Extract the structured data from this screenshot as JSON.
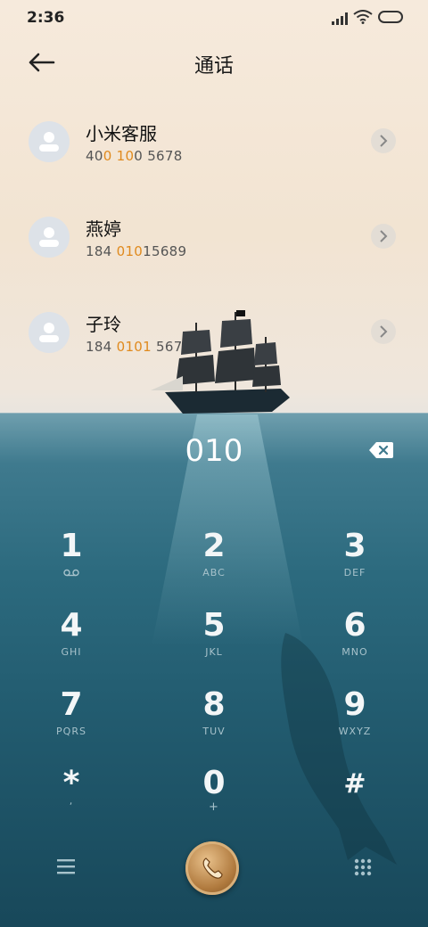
{
  "status_bar": {
    "time": "2:36"
  },
  "header": {
    "title": "通话"
  },
  "contacts": [
    {
      "name": "小米客服",
      "number_parts": [
        "40",
        "0",
        " ",
        "10",
        "0 5678"
      ]
    },
    {
      "name": "燕婷",
      "number_parts": [
        "184 ",
        "010",
        "15689",
        "",
        ""
      ]
    },
    {
      "name": "子玲",
      "number_parts": [
        "184 ",
        "0101",
        " 5678",
        "",
        ""
      ]
    }
  ],
  "dialer": {
    "input": "010"
  },
  "keypad": [
    {
      "digit": "1",
      "letters": ""
    },
    {
      "digit": "2",
      "letters": "ABC"
    },
    {
      "digit": "3",
      "letters": "DEF"
    },
    {
      "digit": "4",
      "letters": "GHI"
    },
    {
      "digit": "5",
      "letters": "JKL"
    },
    {
      "digit": "6",
      "letters": "MNO"
    },
    {
      "digit": "7",
      "letters": "PQRS"
    },
    {
      "digit": "8",
      "letters": "TUV"
    },
    {
      "digit": "9",
      "letters": "WXYZ"
    },
    {
      "digit": "*",
      "letters": ","
    },
    {
      "digit": "0",
      "letters": "+"
    },
    {
      "digit": "#",
      "letters": ""
    }
  ],
  "colors": {
    "highlight": "#e08a1e",
    "sea": "#235d71"
  },
  "icons": [
    "back-arrow-icon",
    "avatar-icon",
    "chevron-right-icon",
    "backspace-icon",
    "voicemail-icon",
    "menu-icon",
    "call-icon",
    "keypad-icon"
  ]
}
